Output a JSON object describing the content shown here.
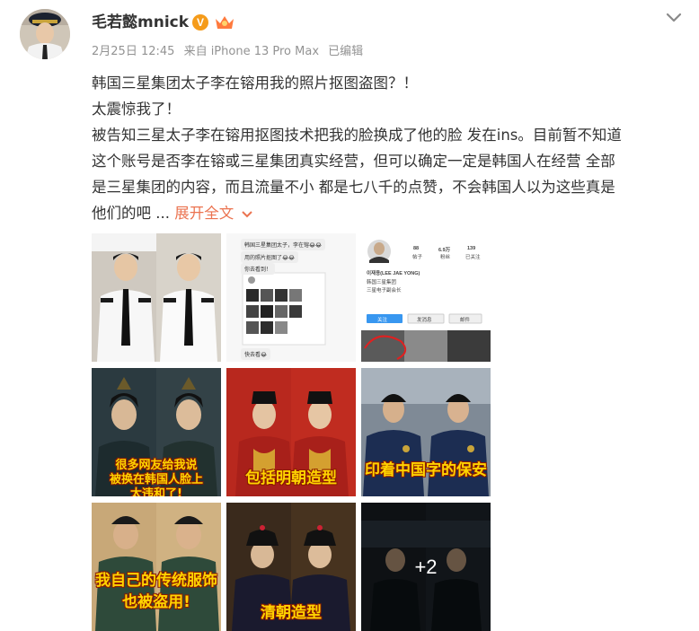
{
  "author": {
    "name": "毛若懿mnick",
    "verified_badge": "V",
    "level_badge_icon": "vip-crown-icon"
  },
  "meta": {
    "date": "2月25日 12:45",
    "source": "来自 iPhone 13 Pro Max",
    "edited": "已编辑"
  },
  "post": {
    "line1": "韩国三星集团太子李在镕用我的照片抠图盗图？！",
    "line2": "太震惊我了！",
    "body_lines": [
      "被告知三星太子李在镕用抠图技术把我的脸换成了他的脸 发在ins。目前暂不知道",
      "这个账号是否李在镕或三星集团真实经营，但可以确定一定是韩国人在经营 全部",
      "是三星集团的内容，而且流量不小 都是七八千的点赞，不会韩国人以为这些真是",
      "他们的吧 ..."
    ],
    "expand_label": "展开全文"
  },
  "images": {
    "captions": {
      "img4": [
        "很多网友给我说",
        "被换在韩国人脸上",
        "太违和了!"
      ],
      "img5": "包括明朝造型",
      "img6": "印着中国字的保安",
      "img7": [
        "我自己的传统服饰",
        "也被盗用!"
      ],
      "img8": "清朝造型"
    },
    "chat": {
      "msg1": "韩国三星集团太子，李在镕😂😂",
      "msg2": "用的照片抠图了😂😂",
      "msg3": "你去看到！",
      "msg4": "快去看😂"
    },
    "profile": {
      "posts": "88",
      "posts_label": "帖子",
      "followers": "6.9万",
      "followers_label": "粉丝",
      "following": "139",
      "following_label": "已关注",
      "display_name": "이재용(LEE JAE YONG)",
      "bio1": "韩国三星集团",
      "bio2": "三星电子副会长",
      "follow_label": "关注",
      "message_label": "发消息",
      "email_label": "邮件"
    },
    "more_count": "+2"
  },
  "colors": {
    "accent": "#eb7350",
    "verified": "#f59b1a",
    "meta_text": "#939393",
    "caption": "#ffd400"
  }
}
